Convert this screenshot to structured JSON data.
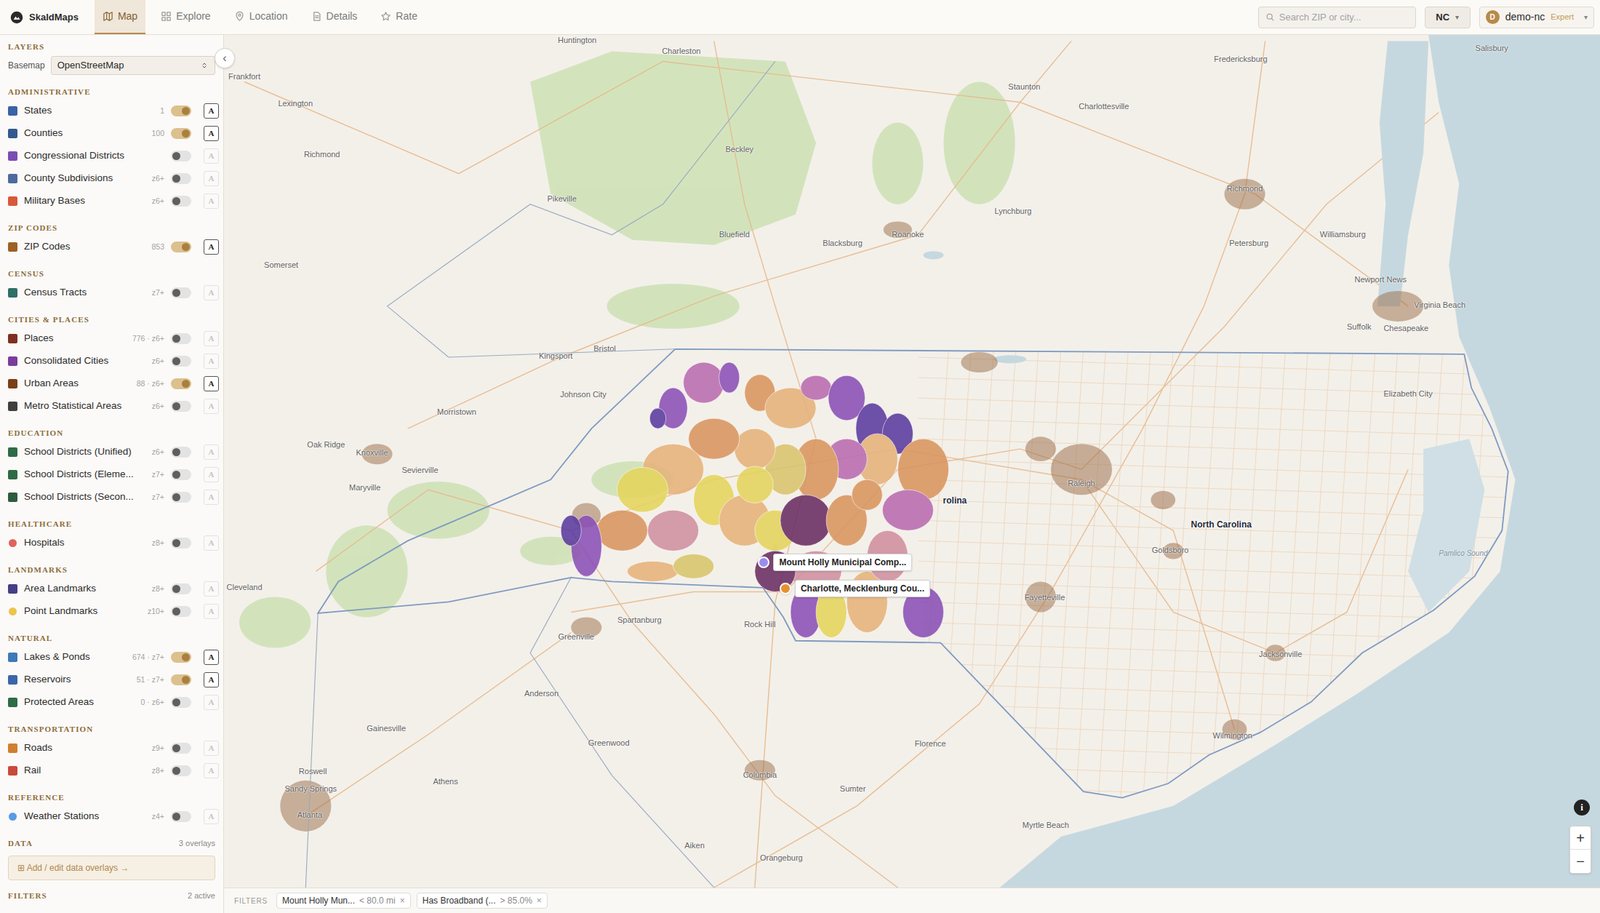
{
  "app": {
    "logo": "SkaldMaps"
  },
  "tabs": [
    {
      "label": "Map",
      "selected": true
    },
    {
      "label": "Explore",
      "selected": false
    },
    {
      "label": "Location",
      "selected": false
    },
    {
      "label": "Details",
      "selected": false
    },
    {
      "label": "Rate",
      "selected": false
    }
  ],
  "search": {
    "placeholder": "Search ZIP or city..."
  },
  "state_picker": {
    "value": "NC",
    "caret": "▾"
  },
  "user": {
    "initial": "D",
    "name": "demo-nc",
    "role": "Expert",
    "caret": "▾"
  },
  "sidebar": {
    "title": "LAYERS",
    "collapse": "‹",
    "basemap": {
      "label": "Basemap",
      "value": "OpenStreetMap"
    },
    "sections": [
      {
        "title": "ADMINISTRATIVE",
        "items": [
          {
            "label": "States",
            "count": "1",
            "on": true,
            "labels": true,
            "label_button": "A",
            "color": "#3a62a7",
            "kind": "swatch"
          },
          {
            "label": "Counties",
            "count": "100",
            "on": true,
            "labels": true,
            "label_button": "A",
            "color": "#34598f",
            "kind": "swatch"
          },
          {
            "label": "Congressional Districts",
            "on": false,
            "labels": false,
            "label_button": "A",
            "color": "#7a4db3",
            "kind": "swatch"
          },
          {
            "label": "County Subdivisions",
            "count": "z6+",
            "on": false,
            "labels": false,
            "label_button": "A",
            "color": "#4d6b9c",
            "kind": "swatch"
          },
          {
            "label": "Military Bases",
            "count": "z6+",
            "on": false,
            "labels": false,
            "label_button": "A",
            "color": "#d8583a",
            "kind": "swatch"
          }
        ]
      },
      {
        "title": "ZIP CODES",
        "items": [
          {
            "label": "ZIP Codes",
            "count": "853",
            "on": true,
            "labels": true,
            "label_button": "A",
            "color": "#9c6127",
            "kind": "swatch"
          }
        ]
      },
      {
        "title": "CENSUS",
        "items": [
          {
            "label": "Census Tracts",
            "count": "z7+",
            "on": false,
            "labels": false,
            "label_button": "A",
            "color": "#2f6f66",
            "kind": "swatch"
          }
        ]
      },
      {
        "title": "CITIES & PLACES",
        "items": [
          {
            "label": "Places",
            "count": "776 · z6+",
            "on": false,
            "labels": false,
            "label_button": "A",
            "color": "#7f2f22",
            "kind": "swatch"
          },
          {
            "label": "Consolidated Cities",
            "count": "z6+",
            "on": false,
            "labels": false,
            "label_button": "A",
            "color": "#7c3b9c",
            "kind": "swatch"
          },
          {
            "label": "Urban Areas",
            "count": "88 · z6+",
            "on": true,
            "labels": true,
            "label_button": "A",
            "color": "#7a3f17",
            "kind": "swatch"
          },
          {
            "label": "Metro Statistical Areas",
            "count": "z6+",
            "on": false,
            "labels": false,
            "label_button": "A",
            "color": "#3f3f3f",
            "kind": "swatch"
          }
        ]
      },
      {
        "title": "EDUCATION",
        "items": [
          {
            "label": "School Districts (Unified)",
            "count": "z6+",
            "on": false,
            "labels": false,
            "label_button": "A",
            "color": "#2e6b46",
            "kind": "swatch"
          },
          {
            "label": "School Districts (Eleme...",
            "count": "z7+",
            "on": false,
            "labels": false,
            "label_button": "A",
            "color": "#2e6b46",
            "kind": "swatch"
          },
          {
            "label": "School Districts (Secon...",
            "count": "z7+",
            "on": false,
            "labels": false,
            "label_button": "A",
            "color": "#2e5b3e",
            "kind": "swatch"
          }
        ]
      },
      {
        "title": "HEALTHCARE",
        "items": [
          {
            "label": "Hospitals",
            "count": "z8+",
            "on": false,
            "labels": false,
            "label_button": "A",
            "color": "#e0645e",
            "kind": "dot"
          }
        ]
      },
      {
        "title": "LANDMARKS",
        "items": [
          {
            "label": "Area Landmarks",
            "count": "z8+",
            "on": false,
            "labels": false,
            "label_button": "A",
            "color": "#433f86",
            "kind": "swatch"
          },
          {
            "label": "Point Landmarks",
            "count": "z10+",
            "on": false,
            "labels": false,
            "label_button": "A",
            "color": "#eec44a",
            "kind": "dot"
          }
        ]
      },
      {
        "title": "NATURAL",
        "items": [
          {
            "label": "Lakes & Ponds",
            "count": "674 · z7+",
            "on": true,
            "labels": true,
            "label_button": "A",
            "color": "#3d79b8",
            "kind": "swatch"
          },
          {
            "label": "Reservoirs",
            "count": "51 · z7+",
            "on": true,
            "labels": true,
            "label_button": "A",
            "color": "#3a67a8",
            "kind": "swatch"
          },
          {
            "label": "Protected Areas",
            "count": "0 · z6+",
            "on": false,
            "labels": false,
            "label_button": "A",
            "color": "#2e6b46",
            "kind": "swatch"
          }
        ]
      },
      {
        "title": "TRANSPORTATION",
        "items": [
          {
            "label": "Roads",
            "count": "z9+",
            "on": false,
            "labels": false,
            "label_button": "A",
            "color": "#cf7f2f",
            "kind": "swatch"
          },
          {
            "label": "Rail",
            "count": "z8+",
            "on": false,
            "labels": false,
            "label_button": "A",
            "color": "#c94a3a",
            "kind": "swatch"
          }
        ]
      },
      {
        "title": "REFERENCE",
        "items": [
          {
            "label": "Weather Stations",
            "count": "z4+",
            "on": false,
            "labels": false,
            "label_button": "A",
            "color": "#5a9ae6",
            "kind": "dot"
          }
        ]
      }
    ],
    "data": {
      "title": "DATA",
      "count": "3 overlays",
      "button": "⊞ Add / edit data overlays →"
    },
    "filters": {
      "title": "FILTERS",
      "count": "2 active"
    }
  },
  "map": {
    "labels": [
      {
        "text": "Huntington",
        "kind": "city"
      },
      {
        "text": "Charleston",
        "kind": "city"
      },
      {
        "text": "Frankfort",
        "kind": "city"
      },
      {
        "text": "Lexington",
        "kind": "city"
      },
      {
        "text": "Richmond",
        "kind": "city"
      },
      {
        "text": "Staunton",
        "kind": "city"
      },
      {
        "text": "Charlottesville",
        "kind": "city"
      },
      {
        "text": "Fredericksburg",
        "kind": "city"
      },
      {
        "text": "Salisbury",
        "kind": "city"
      },
      {
        "text": "Beckley",
        "kind": "city"
      },
      {
        "text": "Pikeville",
        "kind": "city"
      },
      {
        "text": "Bluefield",
        "kind": "city"
      },
      {
        "text": "Blacksburg",
        "kind": "city"
      },
      {
        "text": "Roanoke",
        "kind": "city"
      },
      {
        "text": "Lynchburg",
        "kind": "city"
      },
      {
        "text": "Richmond",
        "kind": "city"
      },
      {
        "text": "Petersburg",
        "kind": "city"
      },
      {
        "text": "Williamsburg",
        "kind": "city"
      },
      {
        "text": "Newport News",
        "kind": "city"
      },
      {
        "text": "Virginia Beach",
        "kind": "city"
      },
      {
        "text": "Suffolk",
        "kind": "city"
      },
      {
        "text": "Chesapeake",
        "kind": "city"
      },
      {
        "text": "Somerset",
        "kind": "city"
      },
      {
        "text": "Kingsport",
        "kind": "city"
      },
      {
        "text": "Bristol",
        "kind": "city"
      },
      {
        "text": "Johnson City",
        "kind": "city"
      },
      {
        "text": "Morristown",
        "kind": "city"
      },
      {
        "text": "Oak Ridge",
        "kind": "city"
      },
      {
        "text": "Knoxville",
        "kind": "city"
      },
      {
        "text": "Sevierville",
        "kind": "city"
      },
      {
        "text": "Maryville",
        "kind": "city"
      },
      {
        "text": "Cleveland",
        "kind": "city"
      },
      {
        "text": "Raleigh",
        "kind": "city"
      },
      {
        "text": "Elizabeth City",
        "kind": "city"
      },
      {
        "text": "Goldsboro",
        "kind": "city"
      },
      {
        "text": "Fayetteville",
        "kind": "city"
      },
      {
        "text": "Jacksonville",
        "kind": "city"
      },
      {
        "text": "Wilmington",
        "kind": "city"
      },
      {
        "text": "Pamlico Sound",
        "kind": "water"
      },
      {
        "text": "Rock Hill",
        "kind": "city"
      },
      {
        "text": "Spartanburg",
        "kind": "city"
      },
      {
        "text": "Greenville",
        "kind": "city"
      },
      {
        "text": "Anderson",
        "kind": "city"
      },
      {
        "text": "Greenwood",
        "kind": "city"
      },
      {
        "text": "Gainesville",
        "kind": "city"
      },
      {
        "text": "Roswell",
        "kind": "city"
      },
      {
        "text": "Sandy Springs",
        "kind": "city"
      },
      {
        "text": "Athens",
        "kind": "city"
      },
      {
        "text": "Atlanta",
        "kind": "city"
      },
      {
        "text": "Columbia",
        "kind": "city"
      },
      {
        "text": "Sumter",
        "kind": "city"
      },
      {
        "text": "Florence",
        "kind": "city"
      },
      {
        "text": "Myrtle Beach",
        "kind": "city"
      },
      {
        "text": "Aiken",
        "kind": "city"
      },
      {
        "text": "Orangeburg",
        "kind": "city"
      },
      {
        "text": "North Carolina",
        "kind": "state"
      },
      {
        "text": "rolina",
        "kind": "state"
      }
    ],
    "regions": [
      {
        "color": "#8a4fb5"
      },
      {
        "color": "#5b3a9e"
      },
      {
        "color": "#b96cb0"
      },
      {
        "color": "#8a4fb5"
      },
      {
        "color": "#d9955f"
      },
      {
        "color": "#e6b27a"
      },
      {
        "color": "#b96cb0"
      },
      {
        "color": "#8a4fb5"
      },
      {
        "color": "#5b3a9e"
      },
      {
        "color": "#5b3a9e"
      },
      {
        "color": "#d9955f"
      },
      {
        "color": "#b96cb0"
      },
      {
        "color": "#e6b27a"
      },
      {
        "color": "#b96cb0"
      },
      {
        "color": "#d9955f"
      },
      {
        "color": "#d9c46c"
      },
      {
        "color": "#e6b27a"
      },
      {
        "color": "#d9955f"
      },
      {
        "color": "#e6b27a"
      },
      {
        "color": "#e4d45c"
      },
      {
        "color": "#d9955f"
      },
      {
        "color": "#8a4fb5"
      },
      {
        "color": "#5b3a9e"
      },
      {
        "color": "#d08fa0"
      },
      {
        "color": "#e4d45c"
      },
      {
        "color": "#e6b27a"
      },
      {
        "color": "#e4d45c"
      },
      {
        "color": "#6a2d62"
      },
      {
        "color": "#d9955f"
      },
      {
        "color": "#d08fa0"
      },
      {
        "color": "#6a2d62"
      },
      {
        "color": "#8a4fb5"
      },
      {
        "color": "#e4d45c"
      },
      {
        "color": "#e6b27a"
      },
      {
        "color": "#8a4fb5"
      },
      {
        "color": "#e6b27a"
      },
      {
        "color": "#d9c46c"
      },
      {
        "color": "#e4d45c"
      },
      {
        "color": "#d08fa0"
      },
      {
        "color": "#d9955f"
      }
    ],
    "pins": [
      {
        "label": "Mount Holly Municipal Comp...",
        "color": "#9b8cf0"
      },
      {
        "label": "Charlotte, Mecklenburg Cou...",
        "color": "#e8902f"
      }
    ],
    "controls": {
      "info": "i",
      "zoom_in": "+",
      "zoom_out": "−"
    }
  },
  "filter_bar": {
    "title": "FILTERS",
    "chips": [
      {
        "label": "Mount Holly Mun...",
        "value": "< 80.0 mi",
        "remove": "×"
      },
      {
        "label": "Has Broadband (...",
        "value": "> 85.0%",
        "remove": "×"
      }
    ]
  }
}
